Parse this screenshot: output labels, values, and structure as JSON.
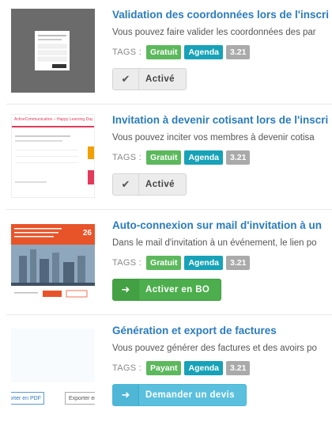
{
  "tags_label": "TAGS :",
  "items": [
    {
      "title": "Validation des coordonnées lors de l'inscri",
      "desc": "Vous pouvez faire valider les coordonnées des par",
      "tags": [
        "Gratuit",
        "Agenda",
        "3.21"
      ],
      "button": {
        "label": "Activé",
        "icon": "check-icon"
      }
    },
    {
      "title": "Invitation à devenir cotisant lors de l'inscri",
      "desc": "Vous pouvez inciter vos membres à devenir cotisa",
      "tags": [
        "Gratuit",
        "Agenda",
        "3.21"
      ],
      "button": {
        "label": "Activé",
        "icon": "check-icon"
      },
      "thumb_text": "ActiveCommunication – Happy Learning Day"
    },
    {
      "title": "Auto-connexion sur mail d'invitation à un",
      "desc": "Dans le mail d'invitation à un événement, le lien po",
      "tags": [
        "Gratuit",
        "Agenda",
        "3.21"
      ],
      "button": {
        "label": "Activer en BO",
        "icon": "sign-in-icon"
      },
      "thumb_date": "26"
    },
    {
      "title": "Génération et export de factures",
      "desc": "Vous pouvez générer des factures et des avoirs po",
      "tags": [
        "Payant",
        "Agenda",
        "3.21"
      ],
      "button": {
        "label": "Demander un devis",
        "icon": "sign-in-icon"
      },
      "thumb_buttons": [
        "Exporter en PDF",
        "Exporter en"
      ]
    }
  ],
  "colors": {
    "title": "#2b7bbd",
    "green": "#5cb85c",
    "teal": "#17a2b8",
    "gray": "#aaaaaa",
    "activate": "#4cae4c",
    "quote": "#5bc0de"
  }
}
